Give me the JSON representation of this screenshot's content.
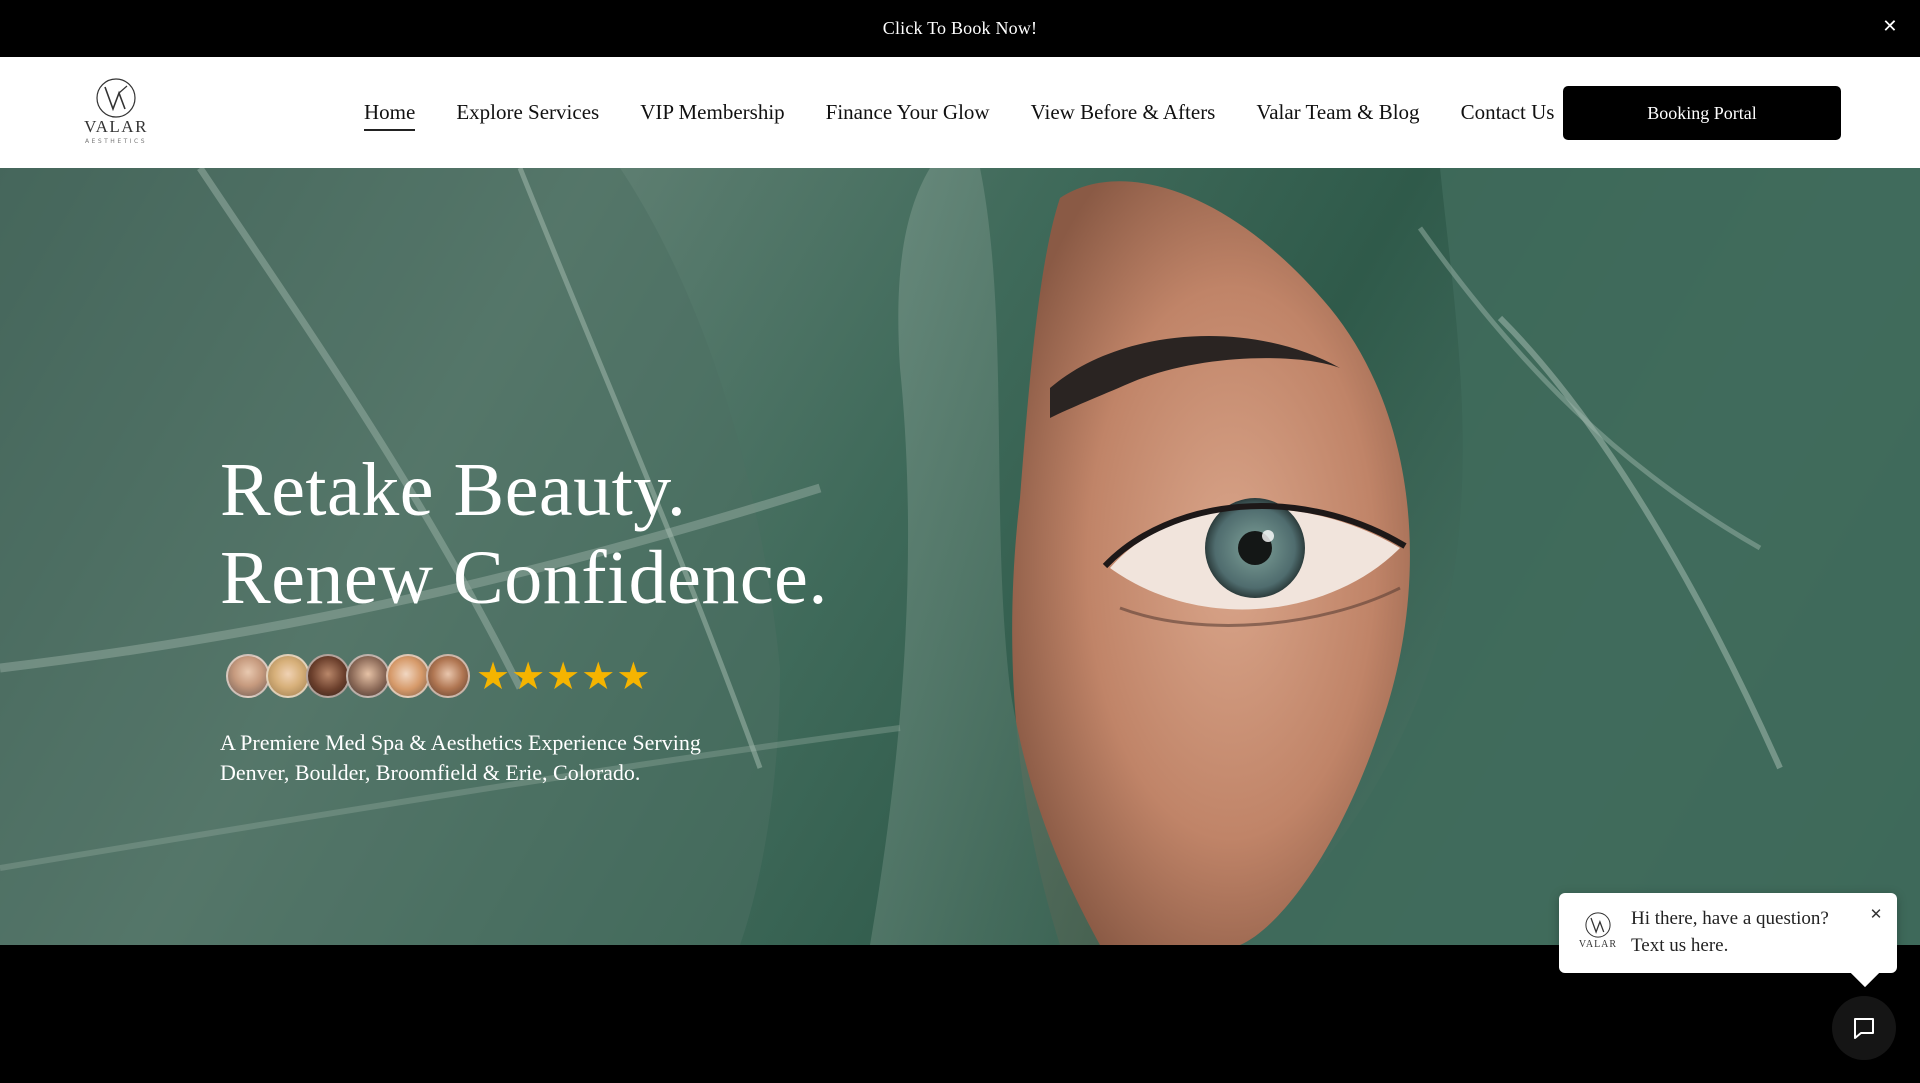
{
  "announcement": {
    "text": "Click To Book Now!",
    "close_icon": "close-icon"
  },
  "header": {
    "logo": {
      "wordmark": "VALAR",
      "subtext": "AESTHETICS"
    },
    "nav": [
      {
        "label": "Home",
        "active": true
      },
      {
        "label": "Explore Services",
        "active": false
      },
      {
        "label": "VIP Membership",
        "active": false
      },
      {
        "label": "Finance Your Glow",
        "active": false
      },
      {
        "label": "View Before & Afters",
        "active": false
      },
      {
        "label": "Valar Team & Blog",
        "active": false
      },
      {
        "label": "Contact Us",
        "active": false
      }
    ],
    "cta_label": "Booking Portal"
  },
  "hero": {
    "title_line1": "Retake Beauty.",
    "title_line2": "Renew Confidence.",
    "rating_stars": 5,
    "star_color": "#f5b400",
    "reviewer_avatar_count": 6,
    "subtitle_line1": "A Premiere Med Spa & Aesthetics Experience Serving",
    "subtitle_line2": "Denver, Boulder, Broomfield & Erie, Colorado."
  },
  "chat": {
    "message_line1": "Hi there, have a question?",
    "message_line2": "Text us here.",
    "logo_wordmark": "VALAR",
    "launcher_icon": "chat-icon",
    "close_icon": "close-icon"
  }
}
